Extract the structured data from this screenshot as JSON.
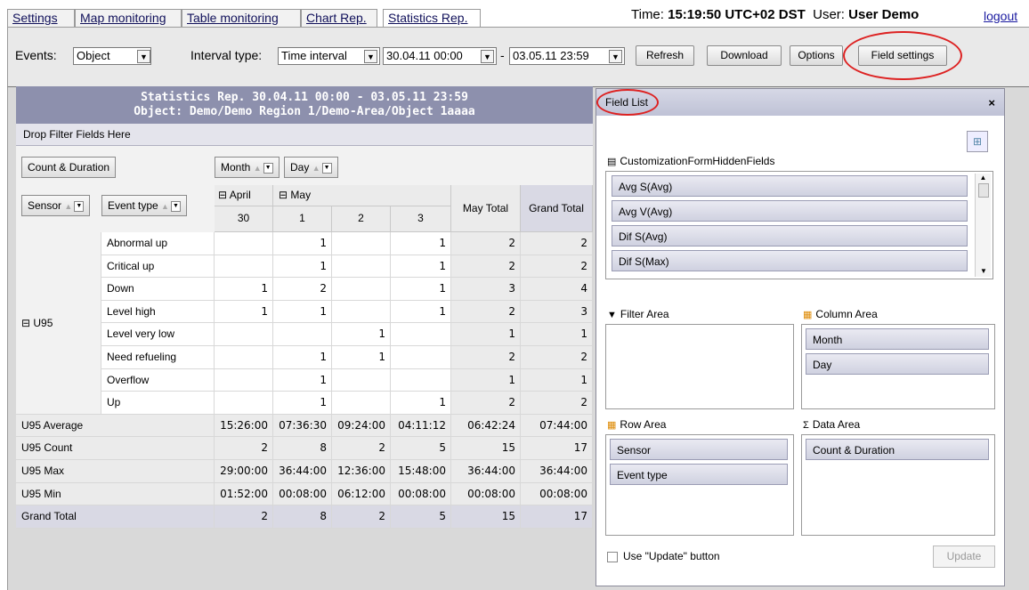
{
  "tabs": [
    "Settings",
    "Map monitoring",
    "Table monitoring",
    "Chart Rep.",
    "Statistics Rep."
  ],
  "time_label": "Time:",
  "time_value": "15:19:50 UTC+02 DST",
  "user_label": "User:",
  "user_value": "User Demo",
  "logout": "logout",
  "toolbar": {
    "events_label": "Events:",
    "events_value": "Object",
    "interval_label": "Interval type:",
    "interval_value": "Time interval",
    "date_from": "30.04.11 00:00",
    "date_sep": "-",
    "date_to": "03.05.11 23:59",
    "refresh": "Refresh",
    "download": "Download",
    "options": "Options",
    "field_settings": "Field settings"
  },
  "grid": {
    "title1": "Statistics Rep. 30.04.11 00:00 - 03.05.11 23:59",
    "title2": "Object: Demo/Demo Region 1/Demo-Area/Object 1aaaa",
    "drop_filter": "Drop Filter Fields Here",
    "count_duration": "Count & Duration",
    "month": "Month",
    "day": "Day",
    "sensor": "Sensor",
    "event_type": "Event type",
    "april": "April",
    "may": "May",
    "may_total": "May Total",
    "grand_total": "Grand Total",
    "days": [
      "30",
      "1",
      "2",
      "3"
    ],
    "sensor_value": "U95",
    "rows": [
      {
        "label": "Abnormal up",
        "v": [
          "",
          "1",
          "",
          "1",
          "2",
          "2"
        ]
      },
      {
        "label": "Critical up",
        "v": [
          "",
          "1",
          "",
          "1",
          "2",
          "2"
        ]
      },
      {
        "label": "Down",
        "v": [
          "1",
          "2",
          "",
          "1",
          "3",
          "4"
        ]
      },
      {
        "label": "Level high",
        "v": [
          "1",
          "1",
          "",
          "1",
          "2",
          "3"
        ]
      },
      {
        "label": "Level very low",
        "v": [
          "",
          "",
          "1",
          "",
          "1",
          "1"
        ]
      },
      {
        "label": "Need refueling",
        "v": [
          "",
          "1",
          "1",
          "",
          "2",
          "2"
        ]
      },
      {
        "label": "Overflow",
        "v": [
          "",
          "1",
          "",
          "",
          "1",
          "1"
        ]
      },
      {
        "label": "Up",
        "v": [
          "",
          "1",
          "",
          "1",
          "2",
          "2"
        ]
      }
    ],
    "totals": [
      {
        "label": "U95 Average",
        "v": [
          "15:26:00",
          "07:36:30",
          "09:24:00",
          "04:11:12",
          "06:42:24",
          "07:44:00"
        ]
      },
      {
        "label": "U95 Count",
        "v": [
          "2",
          "8",
          "2",
          "5",
          "15",
          "17"
        ]
      },
      {
        "label": "U95 Max",
        "v": [
          "29:00:00",
          "36:44:00",
          "12:36:00",
          "15:48:00",
          "36:44:00",
          "36:44:00"
        ]
      },
      {
        "label": "U95 Min",
        "v": [
          "01:52:00",
          "00:08:00",
          "06:12:00",
          "00:08:00",
          "00:08:00",
          "00:08:00"
        ]
      },
      {
        "label": "Grand Total",
        "v": [
          "2",
          "8",
          "2",
          "5",
          "15",
          "17"
        ]
      }
    ]
  },
  "panel": {
    "title": "Field List",
    "close": "×",
    "hidden_fields_title": "CustomizationFormHiddenFields",
    "hidden_fields": [
      "Avg S(Avg)",
      "Avg V(Avg)",
      "Dif S(Avg)",
      "Dif S(Max)"
    ],
    "filter_area": "Filter Area",
    "column_area": "Column Area",
    "row_area": "Row Area",
    "data_area": "Data Area",
    "column_fields": [
      "Month",
      "Day"
    ],
    "row_fields": [
      "Sensor",
      "Event type"
    ],
    "data_fields": [
      "Count & Duration"
    ],
    "use_update": "Use \"Update\" button",
    "update": "Update"
  },
  "colors": {
    "header": "#8d90ad",
    "highlight": "#d22222"
  }
}
